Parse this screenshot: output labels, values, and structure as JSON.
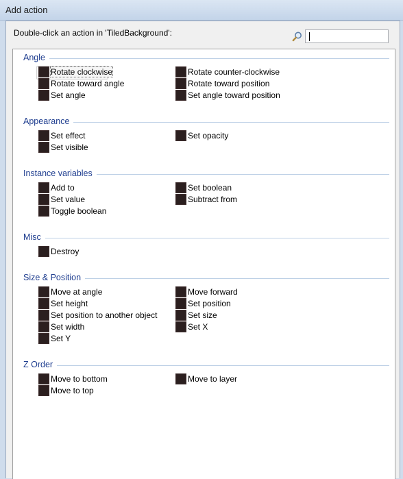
{
  "window": {
    "title": "Add action"
  },
  "header": {
    "instruction": "Double-click an action in 'TiledBackground':"
  },
  "search": {
    "value": ""
  },
  "categories": [
    {
      "name": "Angle",
      "items": [
        "Rotate clockwise",
        "Rotate counter-clockwise",
        "Rotate toward angle",
        "Rotate toward position",
        "Set angle",
        "Set angle toward position"
      ]
    },
    {
      "name": "Appearance",
      "items": [
        "Set effect",
        "Set opacity",
        "Set visible"
      ]
    },
    {
      "name": "Instance variables",
      "items": [
        "Add to",
        "Set boolean",
        "Set value",
        "Subtract from",
        "Toggle boolean"
      ]
    },
    {
      "name": "Misc",
      "items": [
        "Destroy"
      ]
    },
    {
      "name": "Size & Position",
      "items": [
        "Move at angle",
        "Move forward",
        "Set height",
        "Set position",
        "Set position to another object",
        "Set size",
        "Set width",
        "Set X",
        "Set Y"
      ]
    },
    {
      "name": "Z Order",
      "items": [
        "Move to bottom",
        "Move to layer",
        "Move to top"
      ]
    }
  ],
  "selected_item": "Rotate clockwise",
  "colors": {
    "category_text": "#1e3d8f",
    "category_line": "#bdd0e6",
    "icon": "#2b1f1f"
  }
}
